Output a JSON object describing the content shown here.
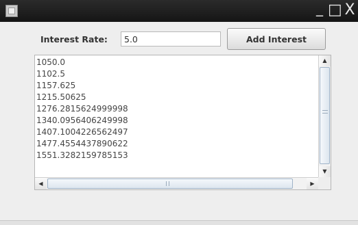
{
  "titlebar": {
    "title": "",
    "minimize_glyph": "_",
    "maximize_glyph": "□",
    "close_glyph": "X"
  },
  "form": {
    "rate_label": "Interest Rate:",
    "rate_value": "5.0",
    "add_button_label": "Add Interest"
  },
  "output": {
    "lines": [
      "1050.0",
      "1102.5",
      "1157.625",
      "1215.50625",
      "1276.2815624999998",
      "1340.0956406249998",
      "1407.1004226562497",
      "1477.4554437890622",
      "1551.3282159785153"
    ]
  },
  "scrollbars": {
    "up_arrow": "▲",
    "down_arrow": "▼",
    "left_arrow": "◀",
    "right_arrow": "▶"
  },
  "icons": {
    "app": "window-icon",
    "minimize": "minimize-icon",
    "maximize": "maximize-icon",
    "close": "close-icon"
  }
}
